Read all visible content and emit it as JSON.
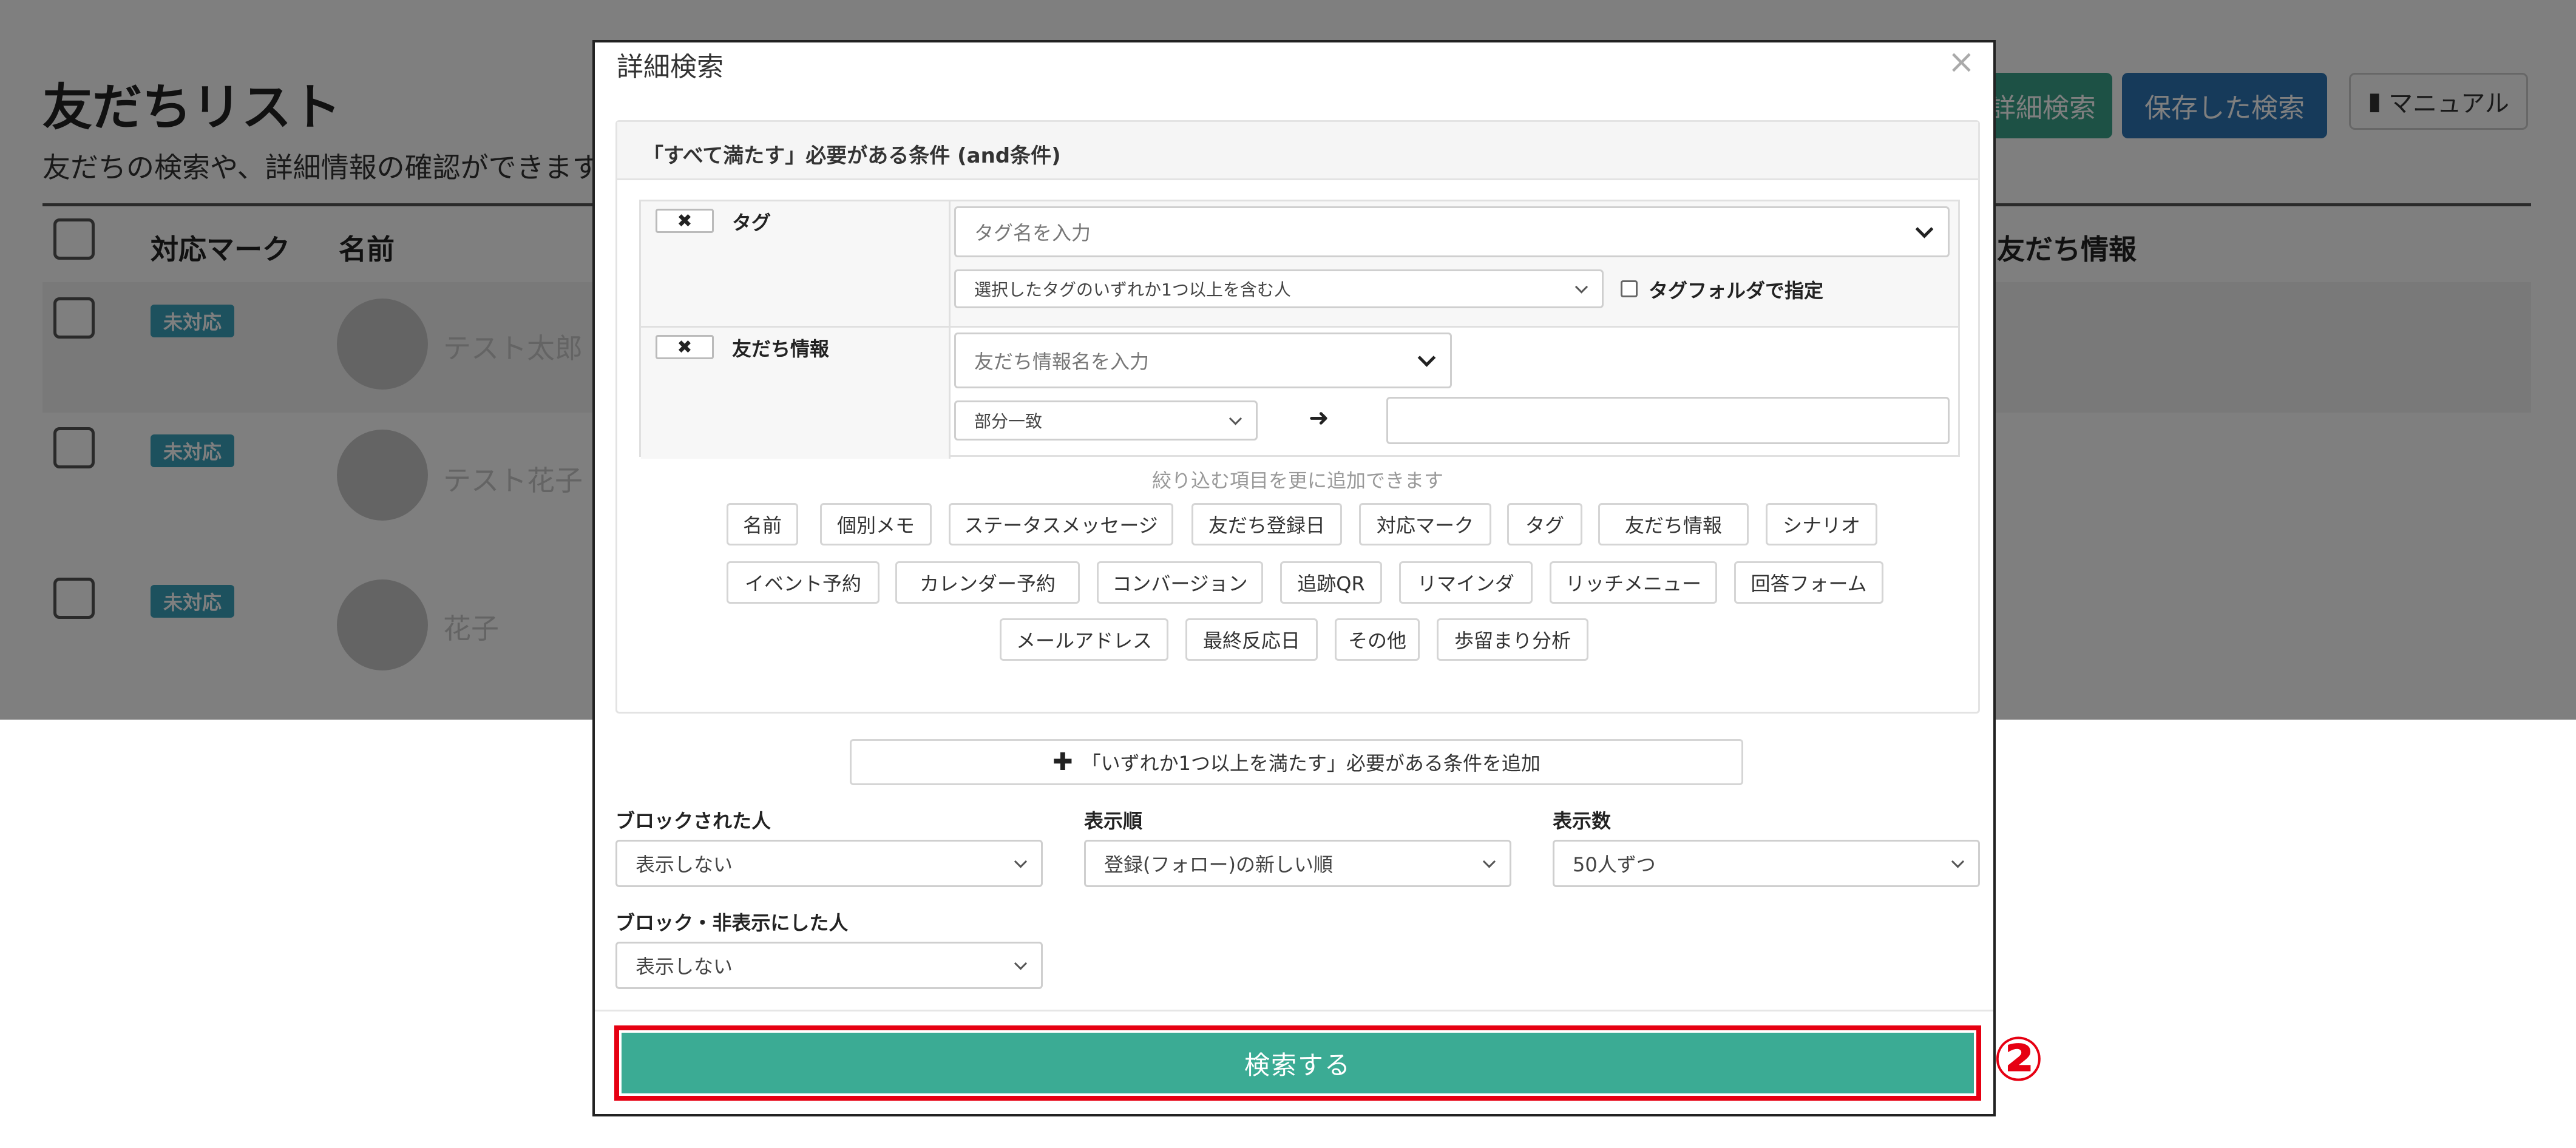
{
  "background": {
    "title": "友だちリスト",
    "subtitle": "友だちの検索や、詳細情報の確認ができます。",
    "buttons": {
      "detail_search": "詳細検索",
      "saved_search": "保存した検索",
      "manual": "マニュアル"
    },
    "columns": {
      "mark": "対応マーク",
      "name": "名前",
      "friend_info": "友だち情報"
    },
    "rows": [
      {
        "badge": "未対応",
        "name": "テスト太郎"
      },
      {
        "badge": "未対応",
        "name": "テスト花子"
      },
      {
        "badge": "未対応",
        "name": "花子"
      }
    ]
  },
  "modal": {
    "title": "詳細検索",
    "close": "×",
    "and_panel": {
      "heading": "「すべて満たす」必要がある条件 (and条件)",
      "conditions": [
        {
          "remove": "✖",
          "label": "タグ",
          "input_placeholder": "タグ名を入力",
          "match_select": "選択したタグのいずれか1つ以上を含む人",
          "folder_checkbox": "タグフォルダで指定"
        },
        {
          "remove": "✖",
          "label": "友だち情報",
          "input_placeholder": "友だち情報名を入力",
          "match_select": "部分一致",
          "arrow": "➜",
          "value": ""
        }
      ],
      "hint": "絞り込む項目を更に追加できます",
      "chips_row1": [
        "名前",
        "個別メモ",
        "ステータスメッセージ",
        "友だち登録日",
        "対応マーク",
        "タグ",
        "友だち情報",
        "シナリオ"
      ],
      "chips_row2": [
        "イベント予約",
        "カレンダー予約",
        "コンバージョン",
        "追跡QR",
        "リマインダ",
        "リッチメニュー",
        "回答フォーム"
      ],
      "chips_row3": [
        "メールアドレス",
        "最終反応日",
        "その他",
        "歩留まり分析"
      ]
    },
    "or_button": {
      "icon": "✚",
      "label": "「いずれか1つ以上を満たす」必要がある条件を追加"
    },
    "filters": {
      "blocked": {
        "label": "ブロックされた人",
        "value": "表示しない"
      },
      "order": {
        "label": "表示順",
        "value": "登録(フォロー)の新しい順"
      },
      "count": {
        "label": "表示数",
        "value": "50人ずつ"
      },
      "blocked_hidden": {
        "label": "ブロック・非表示にした人",
        "value": "表示しない"
      }
    },
    "search_button": "検索する"
  },
  "annotation": {
    "step": "②",
    "highlight_color": "#e60012"
  }
}
